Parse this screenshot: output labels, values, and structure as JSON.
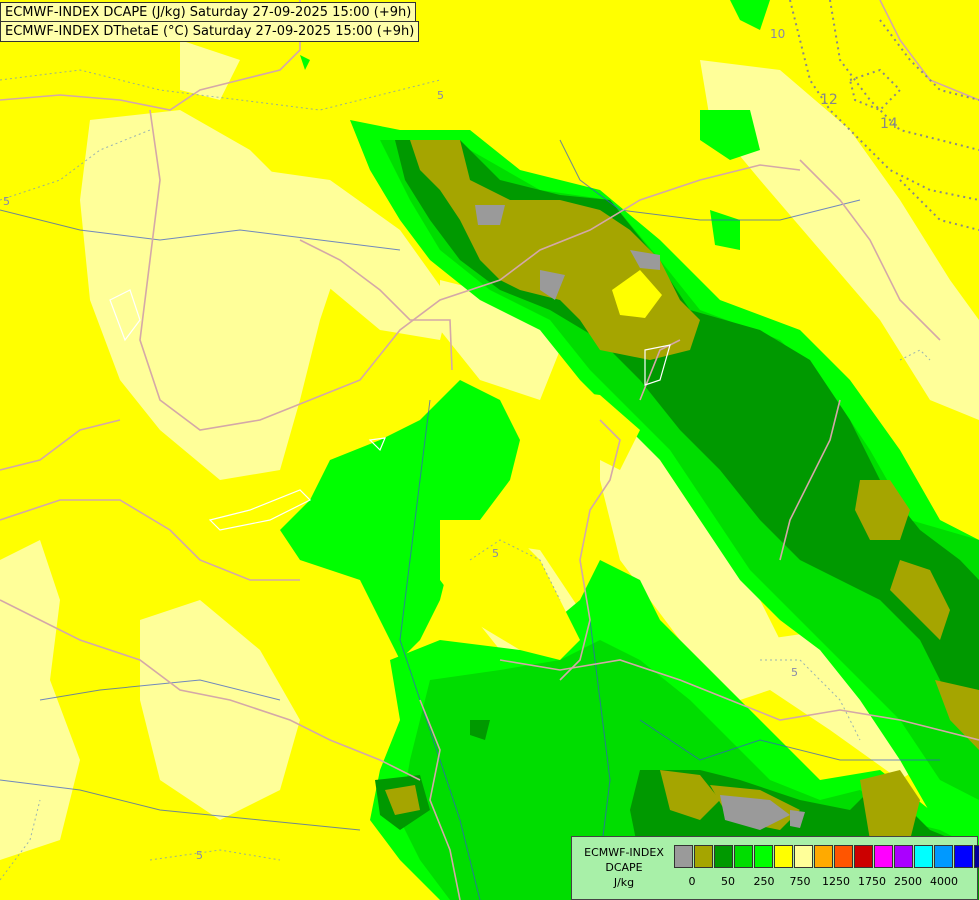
{
  "header": {
    "line1": "ECMWF-INDEX DCAPE (J/kg) Saturday 27-09-2025 15:00 (+9h)",
    "line2": "ECMWF-INDEX DThetaE (°C) Saturday 27-09-2025 15:00 (+9h)"
  },
  "contour_labels": [
    "5",
    "5",
    "5",
    "5",
    "5",
    "10",
    "12",
    "14"
  ],
  "legend": {
    "source": "ECMWF-INDEX",
    "param": "DCAPE",
    "unit": "J/kg",
    "colors": [
      "#9a9a9a",
      "#a5a500",
      "#009900",
      "#00dd00",
      "#00ff00",
      "#ffff00",
      "#ffff99",
      "#ffaa00",
      "#ff5500",
      "#cc0000",
      "#ff00ff",
      "#aa00ff",
      "#00ffff",
      "#0099ff",
      "#0000ff",
      "#000099"
    ],
    "ticks": [
      "0",
      "50",
      "250",
      "750",
      "1250",
      "1750",
      "2500",
      "4000"
    ]
  },
  "colors": {
    "background": "#ffff00",
    "light_yellow": "#ffff99",
    "light_green": "#00ff00",
    "mid_green": "#00dd00",
    "dark_green": "#009900",
    "olive": "#a5a500",
    "grey": "#9a9a9a"
  }
}
